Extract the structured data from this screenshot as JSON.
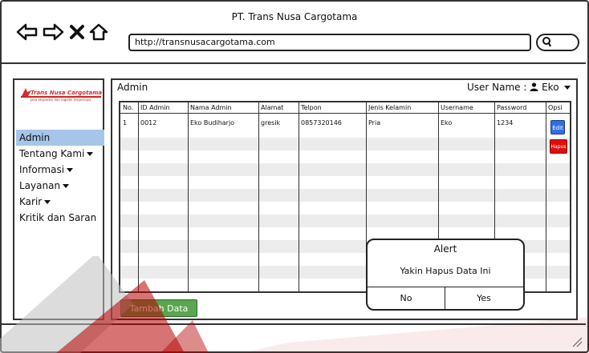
{
  "window": {
    "title": "PT. Trans Nusa Cargotama"
  },
  "browser": {
    "url": "http://transnusacargotama.com",
    "back_icon": "arrow-left-icon",
    "forward_icon": "arrow-right-icon",
    "stop_icon": "close-icon",
    "home_icon": "home-icon",
    "search_icon": "search-icon"
  },
  "logo": {
    "name": "Trans Nusa Cargotama",
    "tagline": "Jasa ekspedisi dan logistik terpercaya"
  },
  "sidebar": {
    "items": [
      {
        "label": "Admin",
        "active": true,
        "caret": false
      },
      {
        "label": "Tentang Kami",
        "active": false,
        "caret": true
      },
      {
        "label": "Informasi",
        "active": false,
        "caret": true
      },
      {
        "label": "Layanan",
        "active": false,
        "caret": true
      },
      {
        "label": "Karir",
        "active": false,
        "caret": true
      },
      {
        "label": "Kritik dan Saran",
        "active": false,
        "caret": false
      }
    ]
  },
  "header": {
    "title": "Admin",
    "user_label": "User Name :",
    "user_name": "Eko",
    "user_icon": "user-icon"
  },
  "table": {
    "columns": [
      "No.",
      "ID Admin",
      "Nama Admin",
      "Alamat",
      "Telpon",
      "Jenis Kelamin",
      "Username",
      "Password",
      "Opsi"
    ],
    "rows": [
      [
        "1",
        "0012",
        "Eko Budiharjo",
        "gresik",
        "0857320146",
        "Pria",
        "Eko",
        "1234"
      ]
    ],
    "edit_label": "Edit",
    "delete_label": "Hapus"
  },
  "alert": {
    "title": "Alert",
    "message": "Yakin Hapus Data Ini",
    "no_label": "No",
    "yes_label": "Yes"
  },
  "actions": {
    "add_label": "Tambah Data"
  },
  "colors": {
    "active_menu": "#a7c4e9",
    "edit": "#2f6fe2",
    "delete": "#e00d0d",
    "add": "#5aa54f",
    "watermark": "#b40000"
  }
}
